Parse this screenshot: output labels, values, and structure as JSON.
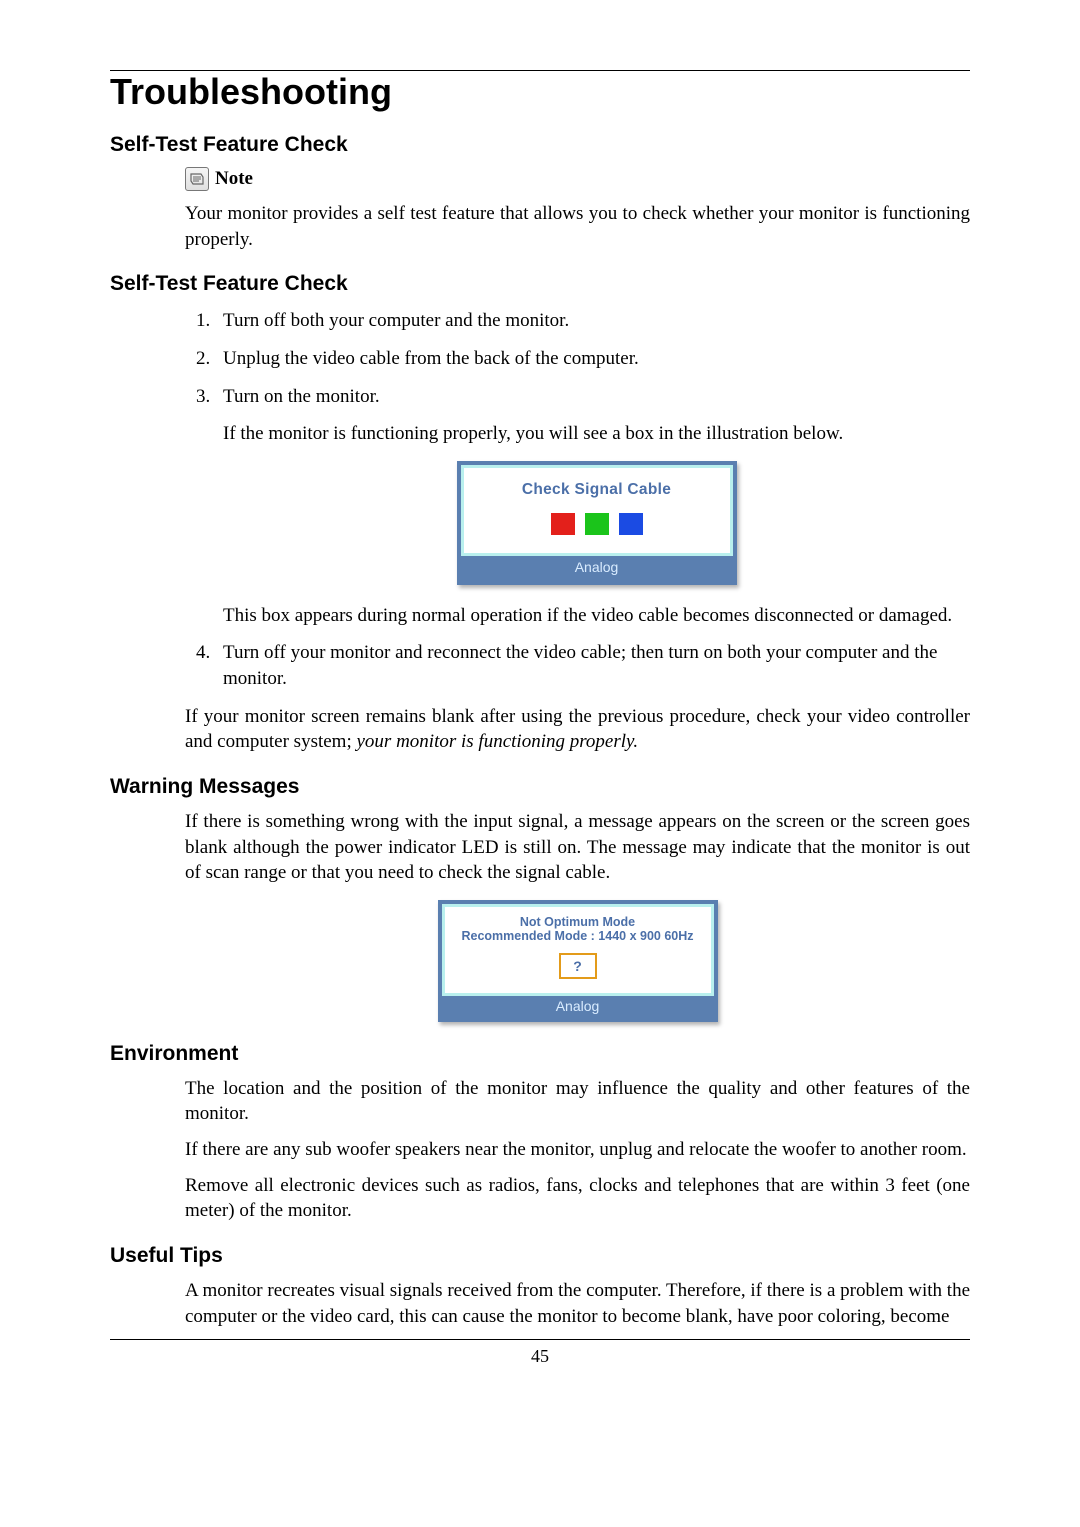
{
  "pageNumber": "45",
  "title": "Troubleshooting",
  "sections": {
    "selfTest1": {
      "heading": "Self-Test Feature Check",
      "noteLabel": "Note",
      "noteText": "Your monitor provides a self test feature that allows you to check whether your monitor is functioning properly."
    },
    "selfTest2": {
      "heading": "Self-Test Feature Check",
      "steps": {
        "s1": "Turn off both your computer and the monitor.",
        "s2": "Unplug the video cable from the back of the computer.",
        "s3": "Turn on the monitor.",
        "s3_after": "If the monitor is functioning properly, you will see a box in the illustration below.",
        "s3_box_msg": "Check Signal Cable",
        "s3_box_footer": "Analog",
        "s3_after_box": "This box appears during normal operation if the video cable becomes disconnected or damaged.",
        "s4": "Turn off your monitor and reconnect the video cable; then turn on both your computer and the monitor."
      },
      "closing_plain": "If your monitor screen remains blank after using the previous procedure, check your video controller and computer system; ",
      "closing_italic": "your monitor is functioning properly."
    },
    "warning": {
      "heading": "Warning Messages",
      "text": "If there is something wrong with the input signal, a message appears on the screen or the screen goes blank although the power indicator LED is still on. The message may indicate that the monitor is out of scan range or that you need to check the signal cable.",
      "box_line1": "Not Optimum Mode",
      "box_line2": "Recommended Mode : 1440 x  900   60Hz",
      "box_q": "?",
      "box_footer": "Analog"
    },
    "environment": {
      "heading": "Environment",
      "p1": "The location and the position of the monitor may influence the quality and other features of the monitor.",
      "p2": "If there are any sub woofer speakers near the monitor, unplug and relocate the woofer to another room.",
      "p3": "Remove all electronic devices such as radios, fans, clocks and telephones that are within 3 feet (one meter) of the monitor."
    },
    "tips": {
      "heading": "Useful Tips",
      "p1": "A monitor recreates visual signals received from the computer. Therefore, if there is a problem with the computer or the video card, this can cause the monitor to become blank, have poor coloring, become"
    }
  }
}
